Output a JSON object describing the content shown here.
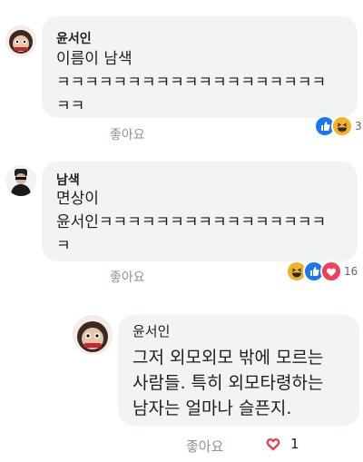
{
  "comments": [
    {
      "author": "윤서인",
      "text": "이름이 남색\nㅋㅋㅋㅋㅋㅋㅋㅋㅋㅋㅋㅋㅋㅋㅋㅋㅋㅋㅋ\nㅋㅋ",
      "like_label": "좋아요",
      "reaction_count": "3",
      "reactions": [
        "like-icon",
        "haha-icon"
      ]
    },
    {
      "author": "남색",
      "text": "면상이\n윤서인ㅋㅋㅋㅋㅋㅋㅋㅋㅋㅋㅋㅋㅋㅋㅋㅋ\nㅋ",
      "like_label": "좋아요",
      "reaction_count": "16",
      "reactions": [
        "haha-icon",
        "like-icon",
        "love-icon"
      ]
    },
    {
      "author": "윤서인",
      "text": "그저 외모외모 밖에 모르는\n사람들. 특히 외모타령하는\n남자는 얼마나 슬픈지.",
      "like_label": "좋아요",
      "reaction_count": "1",
      "reactions": [
        "heart-outline-icon"
      ]
    }
  ],
  "colors": {
    "bubble": "#f2f3f5",
    "like_blue": "#1877f2",
    "haha_yellow": "#f7b125",
    "love_red": "#f33e58",
    "meta_gray": "#8d949e"
  }
}
